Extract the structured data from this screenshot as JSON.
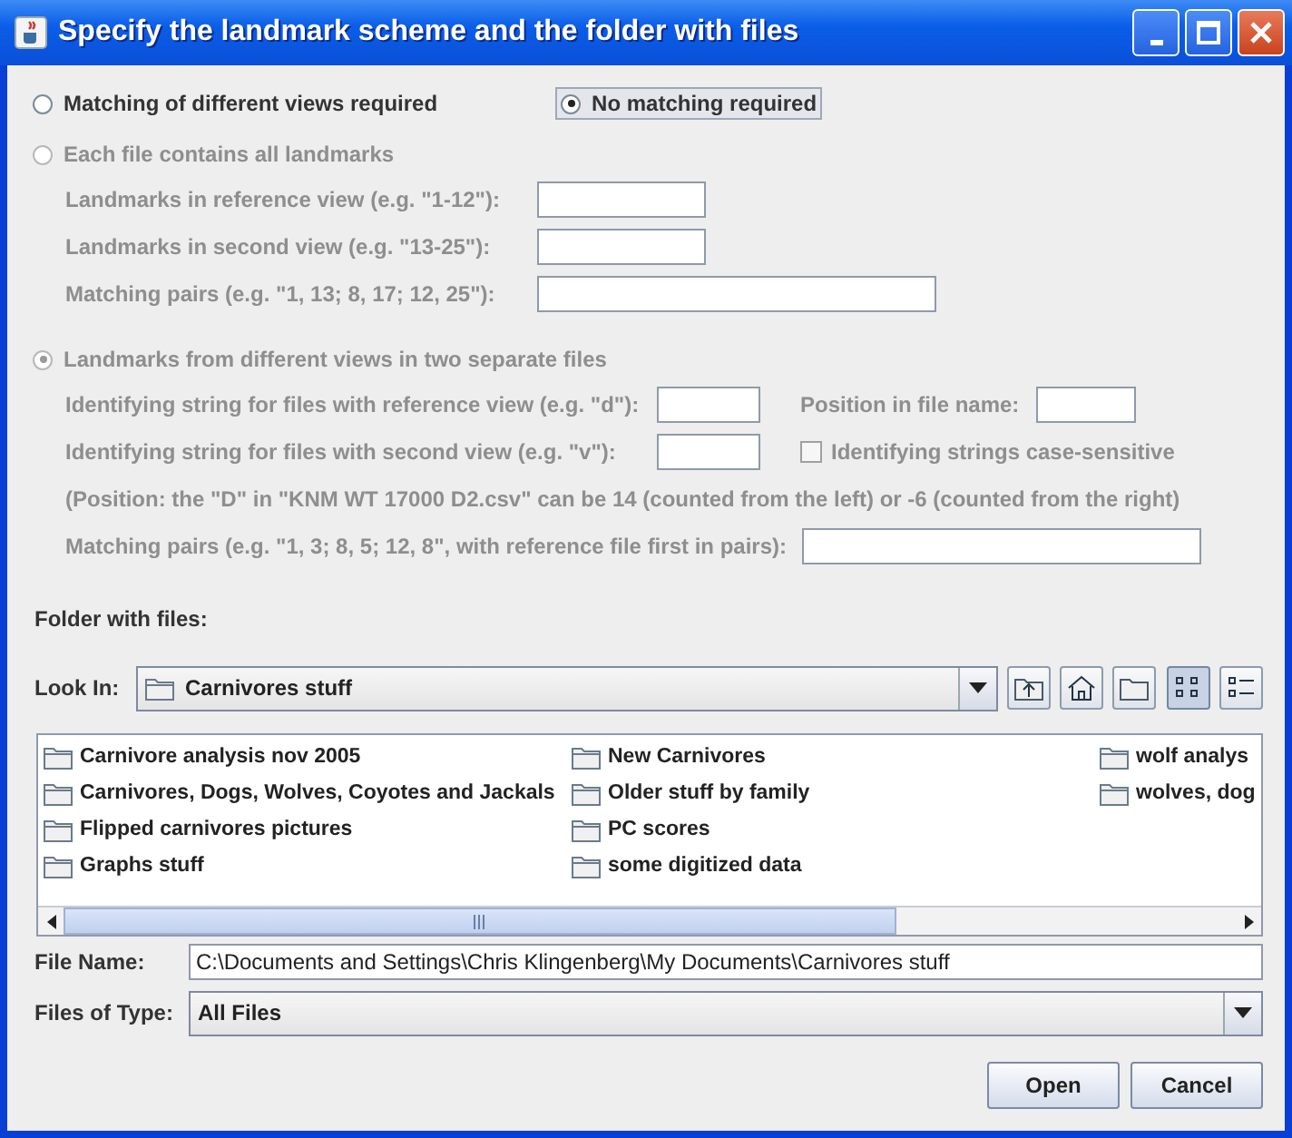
{
  "window": {
    "title": "Specify the landmark scheme and the folder with files"
  },
  "mode_options": [
    {
      "label": "Matching of different views required",
      "selected": false,
      "focused": false
    },
    {
      "label": "No matching required",
      "selected": true,
      "focused": true
    }
  ],
  "single_file": {
    "label": "Each file contains all landmarks",
    "selected": false,
    "disabled": true,
    "fields": [
      {
        "label": "Landmarks in reference view (e.g. \"1-12\"):",
        "kind": "short"
      },
      {
        "label": "Landmarks in second view (e.g. \"13-25\"):",
        "kind": "short"
      },
      {
        "label": "Matching pairs (e.g. \"1, 13; 8, 17; 12, 25\"):",
        "kind": "long"
      }
    ]
  },
  "separate_files": {
    "label": "Landmarks from different views in two separate files",
    "selected": true,
    "disabled": true,
    "reference_id": {
      "label": "Identifying string for files with reference view (e.g. \"d\"):"
    },
    "position": {
      "label": "Position in file name:"
    },
    "second_id": {
      "label": "Identifying string for files with second view (e.g. \"v\"):"
    },
    "case_sensitive": {
      "label": "Identifying strings case-sensitive",
      "checked": false
    },
    "note": "(Position: the \"D\" in \"KNM WT 17000 D2.csv\" can be 14 (counted from the left) or -6 (counted from the right)",
    "matching_pairs": {
      "label": "Matching pairs (e.g. \"1, 3; 8, 5; 12, 8\", with reference file first in pairs):"
    }
  },
  "folder_label": "Folder with files:",
  "chooser": {
    "look_in_label": "Look In:",
    "look_in_value": "Carnivores stuff",
    "view_buttons": [
      {
        "kind": "list",
        "selected": true
      },
      {
        "kind": "details",
        "selected": false
      }
    ],
    "files": [
      "Carnivore analysis nov 2005",
      "Carnivores, Dogs, Wolves, Coyotes and Jackals",
      "Flipped carnivores pictures",
      "Graphs stuff",
      "New Carnivores",
      "Older stuff by family",
      "PC scores",
      "some digitized data",
      "wolf analys",
      "wolves, dog"
    ],
    "file_name_label": "File Name:",
    "file_name_value": "C:\\Documents and Settings\\Chris Klingenberg\\My Documents\\Carnivores stuff",
    "type_label": "Files of Type:",
    "type_value": "All Files"
  },
  "buttons": [
    "Open",
    "Cancel"
  ]
}
